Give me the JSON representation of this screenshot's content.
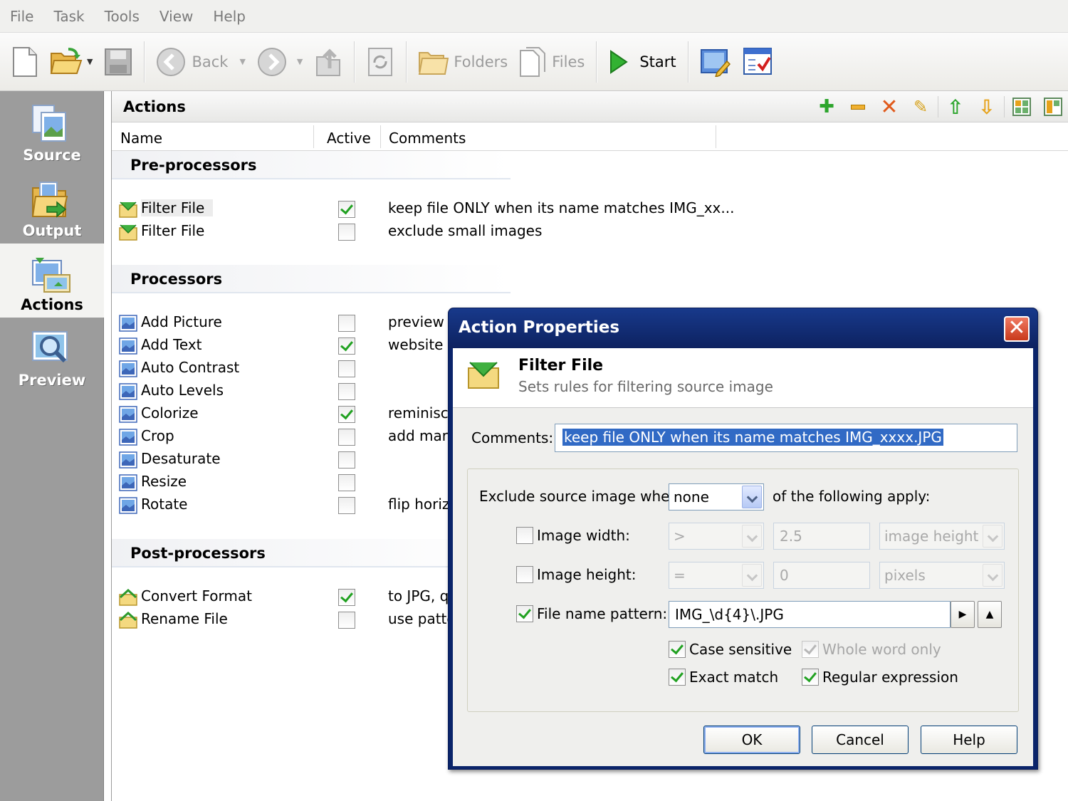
{
  "menu": [
    "File",
    "Task",
    "Tools",
    "View",
    "Help"
  ],
  "toolbar": {
    "back": "Back",
    "folders": "Folders",
    "files": "Files",
    "start": "Start"
  },
  "sidebar": {
    "items": [
      {
        "label": "Source",
        "icon": "source-icon"
      },
      {
        "label": "Output",
        "icon": "output-icon"
      },
      {
        "label": "Actions",
        "icon": "actions-icon",
        "selected": true
      },
      {
        "label": "Preview",
        "icon": "preview-icon"
      }
    ]
  },
  "panel": {
    "title": "Actions",
    "tool_icons": [
      "add-icon",
      "remove-icon",
      "delete-icon",
      "edit-icon",
      "move-up-icon",
      "move-down-icon",
      "view-icon-1",
      "view-icon-2"
    ]
  },
  "columns": {
    "name": "Name",
    "active": "Active",
    "comments": "Comments"
  },
  "groups": {
    "pre": {
      "title": "Pre-processors",
      "rows": [
        {
          "name": "Filter File",
          "active": true,
          "comment": "keep file ONLY when its name matches IMG_xx..."
        },
        {
          "name": "Filter File",
          "active": false,
          "comment": "exclude small images"
        }
      ]
    },
    "proc": {
      "title": "Processors",
      "rows": [
        {
          "name": "Add Picture",
          "active": false,
          "comment": "preview w"
        },
        {
          "name": "Add Text",
          "active": true,
          "comment": "website u"
        },
        {
          "name": "Auto Contrast",
          "active": false,
          "comment": ""
        },
        {
          "name": "Auto Levels",
          "active": false,
          "comment": ""
        },
        {
          "name": "Colorize",
          "active": true,
          "comment": "reminisce"
        },
        {
          "name": "Crop",
          "active": false,
          "comment": "add marg"
        },
        {
          "name": "Desaturate",
          "active": false,
          "comment": ""
        },
        {
          "name": "Resize",
          "active": false,
          "comment": ""
        },
        {
          "name": "Rotate",
          "active": false,
          "comment": "flip horizo"
        }
      ]
    },
    "post": {
      "title": "Post-processors",
      "rows": [
        {
          "name": "Convert Format",
          "active": true,
          "comment": "to JPG, q"
        },
        {
          "name": "Rename File",
          "active": false,
          "comment": "use patte"
        }
      ]
    }
  },
  "dialog": {
    "title": "Action Properties",
    "close": "✕",
    "header_title": "Filter File",
    "header_subtitle": "Sets rules for filtering source image",
    "comments_label": "Comments:",
    "comments_value": "keep file ONLY when its name matches IMG_xxxx.JPG",
    "exclude_label": "Exclude source image when",
    "exclude_value": "none",
    "exclude_suffix": "of the following apply:",
    "width": {
      "label": "Image width:",
      "checked": false,
      "op": ">",
      "value": "2.5",
      "unit": "image height"
    },
    "height": {
      "label": "Image height:",
      "checked": false,
      "op": "=",
      "value": "0",
      "unit": "pixels"
    },
    "pattern": {
      "label": "File name pattern:",
      "checked": true,
      "value": "IMG_\\d{4}\\.JPG"
    },
    "case_sensitive": {
      "label": "Case sensitive",
      "checked": true
    },
    "whole_word": {
      "label": "Whole word only",
      "checked": true,
      "disabled": true
    },
    "exact_match": {
      "label": "Exact match",
      "checked": true
    },
    "regex": {
      "label": "Regular expression",
      "checked": true
    },
    "ok": "OK",
    "cancel": "Cancel",
    "help": "Help"
  }
}
